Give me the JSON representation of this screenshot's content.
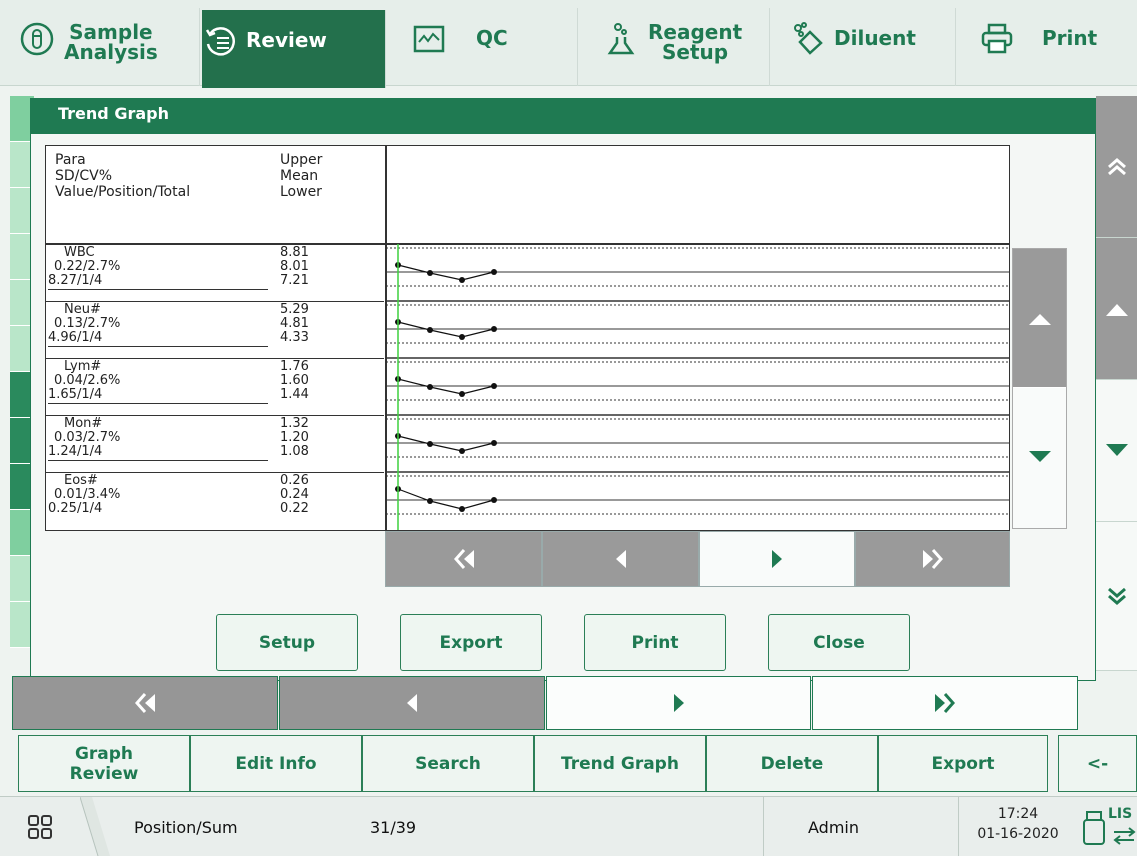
{
  "topnav": {
    "tabs": [
      {
        "label_line1": "Sample",
        "label_line2": "Analysis",
        "icon": "test-tube-icon"
      },
      {
        "label_line1": "Review",
        "label_line2": "",
        "icon": "review-history-icon",
        "active": true
      },
      {
        "label_line1": "QC",
        "label_line2": "",
        "icon": "qc-chart-icon"
      },
      {
        "label_line1": "Reagent",
        "label_line2": "Setup",
        "icon": "flask-icon"
      },
      {
        "label_line1": "Diluent",
        "label_line2": "",
        "icon": "diluent-icon"
      },
      {
        "label_line1": "Print",
        "label_line2": "",
        "icon": "printer-icon"
      }
    ]
  },
  "dialog": {
    "title": "Trend Graph",
    "header": {
      "para": "Para",
      "sdcv": "SD/CV%",
      "vpt": "Value/Position/Total",
      "upper": "Upper",
      "mean": "Mean",
      "lower": "Lower"
    },
    "rows": [
      {
        "name": "WBC",
        "sdcv": "0.22/2.7%",
        "vpt": "8.27/1/4",
        "upper": "8.81",
        "mean": "8.01",
        "lower": "7.21"
      },
      {
        "name": "Neu#",
        "sdcv": "0.13/2.7%",
        "vpt": "4.96/1/4",
        "upper": "5.29",
        "mean": "4.81",
        "lower": "4.33"
      },
      {
        "name": "Lym#",
        "sdcv": "0.04/2.6%",
        "vpt": "1.65/1/4",
        "upper": "1.76",
        "mean": "1.60",
        "lower": "1.44"
      },
      {
        "name": "Mon#",
        "sdcv": "0.03/2.7%",
        "vpt": "1.24/1/4",
        "upper": "1.32",
        "mean": "1.20",
        "lower": "1.08"
      },
      {
        "name": "Eos#",
        "sdcv": "0.01/3.4%",
        "vpt": "0.25/1/4",
        "upper": "0.26",
        "mean": "0.24",
        "lower": "0.22"
      }
    ],
    "buttons": {
      "setup": "Setup",
      "export": "Export",
      "print": "Print",
      "close": "Close"
    }
  },
  "function_bar": {
    "graph_review_1": "Graph",
    "graph_review_2": "Review",
    "edit_info": "Edit Info",
    "search": "Search",
    "trend_graph": "Trend Graph",
    "delete": "Delete",
    "export": "Export",
    "back": "<-"
  },
  "status_bar": {
    "position_label": "Position/Sum",
    "position_value": "31/39",
    "user": "Admin",
    "time": "17:24",
    "date": "01-16-2020",
    "lis": "LIS"
  },
  "colors": {
    "brand_green": "#1f7a52",
    "highlight_green": "#3fd13f"
  }
}
